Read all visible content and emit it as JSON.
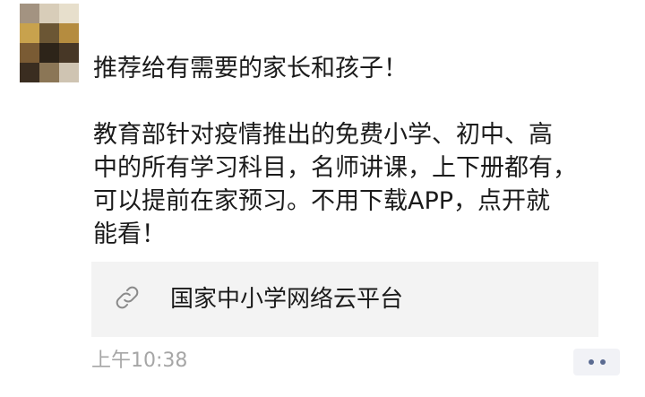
{
  "avatar": {
    "icon": "user-avatar-pixelated",
    "mosaic_colors": [
      "#a39381",
      "#d8cdb9",
      "#e7dfcc",
      "#c8a24d",
      "#6b5634",
      "#b58c3f",
      "#7a5b34",
      "#2d2419",
      "#473726",
      "#3a2d20",
      "#8b7656",
      "#cfc4b2"
    ]
  },
  "post": {
    "headline": "推荐给有需要的家长和孩子！",
    "body_lines": [
      "教育部针对疫情推出的免费小学、初中、高",
      "中的所有学习科目，名师讲课，上下册都有，",
      "可以提前在家预习。不用下载APP，点开就",
      "能看！"
    ]
  },
  "link_card": {
    "icon": "link-icon",
    "title": "国家中小学网络云平台",
    "background": "#f3f3f3"
  },
  "footer": {
    "timestamp": "上午10:38",
    "more_icon": "more-dots-icon",
    "accent": "#5b6b91"
  }
}
